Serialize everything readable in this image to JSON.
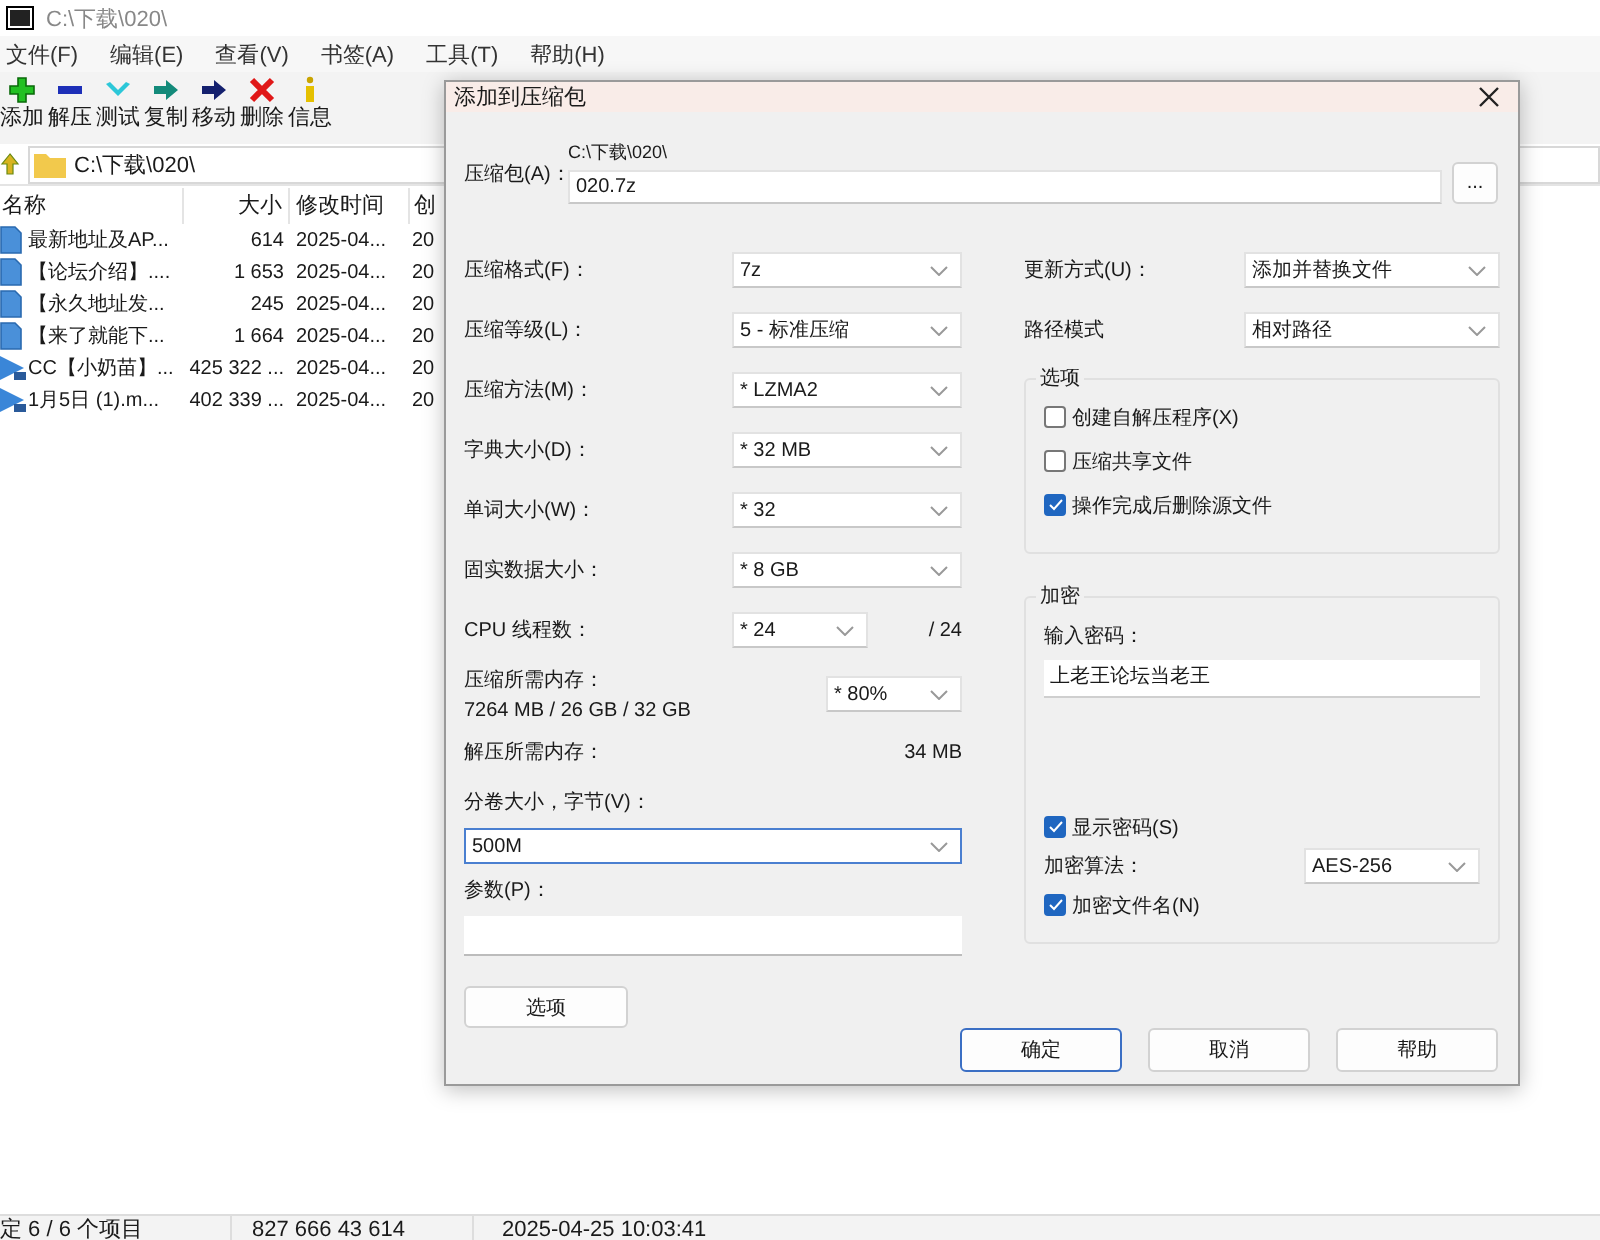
{
  "window": {
    "title": "C:\\下载\\020\\"
  },
  "menu": [
    "文件(F)",
    "编辑(E)",
    "查看(V)",
    "书签(A)",
    "工具(T)",
    "帮助(H)"
  ],
  "toolbar": [
    {
      "kind": "add",
      "label": "添加"
    },
    {
      "kind": "extract",
      "label": "解压"
    },
    {
      "kind": "test",
      "label": "测试"
    },
    {
      "kind": "copy",
      "label": "复制"
    },
    {
      "kind": "move",
      "label": "移动"
    },
    {
      "kind": "delete",
      "label": "删除"
    },
    {
      "kind": "info",
      "label": "信息"
    }
  ],
  "address_bar": {
    "path": "C:\\下载\\020\\"
  },
  "file_list": {
    "columns": [
      "名称",
      "大小",
      "修改时间",
      "创"
    ],
    "rows": [
      {
        "kind": "document",
        "name": "最新地址及AP...",
        "size": "614",
        "modified": "2025-04...",
        "created": "20"
      },
      {
        "kind": "document",
        "name": "【论坛介绍】....",
        "size": "1 653",
        "modified": "2025-04...",
        "created": "20"
      },
      {
        "kind": "document",
        "name": "【永久地址发...",
        "size": "245",
        "modified": "2025-04...",
        "created": "20"
      },
      {
        "kind": "document",
        "name": "【来了就能下...",
        "size": "1 664",
        "modified": "2025-04...",
        "created": "20"
      },
      {
        "kind": "video",
        "name": "CC【小奶苗】...",
        "size": "425 322 ...",
        "modified": "2025-04...",
        "created": "20"
      },
      {
        "kind": "video",
        "name": "1月5日 (1).m...",
        "size": "402 339 ...",
        "modified": "2025-04...",
        "created": "20"
      }
    ]
  },
  "status_bar": [
    "定 6 / 6 个项目",
    "827 666 43 614",
    "2025-04-25 10:03:41"
  ],
  "dialog": {
    "title": "添加到压缩包",
    "archive": {
      "label": "压缩包(A)：",
      "folder": "C:\\下载\\020\\",
      "value": "020.7z",
      "browse": "..."
    },
    "left": [
      {
        "kind": "combo",
        "label": "压缩格式(F)：",
        "value": "7z"
      },
      {
        "kind": "combo",
        "label": "压缩等级(L)：",
        "value": "5 - 标准压缩"
      },
      {
        "kind": "combo",
        "label": "压缩方法(M)：",
        "value": "* LZMA2"
      },
      {
        "kind": "combo",
        "label": "字典大小(D)：",
        "value": "* 32 MB"
      },
      {
        "kind": "combo",
        "label": "单词大小(W)：",
        "value": "* 32"
      },
      {
        "kind": "combo",
        "label": "固实数据大小：",
        "value": "* 8 GB"
      },
      {
        "kind": "threads",
        "label": "CPU 线程数：",
        "value": "* 24",
        "note": "/ 24"
      },
      {
        "kind": "memory",
        "label": "压缩所需内存：",
        "detail": "7264 MB / 26 GB / 32 GB",
        "value": "* 80%"
      },
      {
        "kind": "info",
        "label": "解压所需内存：",
        "value": "34 MB"
      },
      {
        "kind": "wide_combo",
        "label": "分卷大小，字节(V)：",
        "value": "500M",
        "focused": true
      },
      {
        "kind": "text",
        "label": "参数(P)："
      }
    ],
    "options_button": "选项",
    "right": [
      {
        "label": "更新方式(U)：",
        "value": "添加并替换文件"
      },
      {
        "label": "路径模式",
        "value": "相对路径"
      }
    ],
    "options_group": {
      "title": "选项",
      "items": [
        {
          "label": "创建自解压程序(X)",
          "checked": false
        },
        {
          "label": "压缩共享文件",
          "checked": false
        },
        {
          "label": "操作完成后删除源文件",
          "checked": true
        }
      ]
    },
    "encryption": {
      "title": "加密",
      "password_label": "输入密码：",
      "password": "上老王论坛当老王",
      "show_password": {
        "label": "显示密码(S)",
        "checked": true
      },
      "method_label": "加密算法：",
      "method": "AES-256",
      "encrypt_names": {
        "label": "加密文件名(N)",
        "checked": true
      }
    },
    "buttons": [
      {
        "label": "确定",
        "focused": true
      },
      {
        "label": "取消",
        "focused": false
      },
      {
        "label": "帮助",
        "focused": false
      }
    ]
  }
}
